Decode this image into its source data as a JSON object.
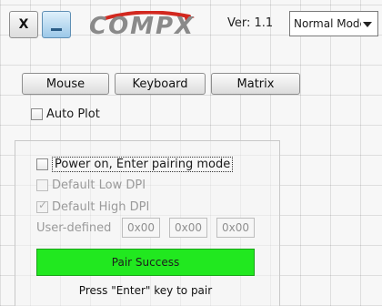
{
  "titlebar": {
    "close_label": "X",
    "logo_text": "COMPX",
    "version_label": "Ver: 1.1",
    "mode_select": {
      "selected": "Normal Mode"
    }
  },
  "tabs": [
    {
      "label": "Mouse"
    },
    {
      "label": "Keyboard"
    },
    {
      "label": "Matrix"
    }
  ],
  "auto_plot": {
    "label": "Auto Plot",
    "checked": false
  },
  "pairing": {
    "power_on": {
      "label": "Power on, Enter pairing mode",
      "checked": false
    },
    "default_low_dpi": {
      "label": "Default Low DPI",
      "checked": false,
      "enabled": false
    },
    "default_high_dpi": {
      "label": "Default High DPI",
      "checked": true,
      "enabled": false
    },
    "user_defined": {
      "label": "User-defined",
      "values": [
        "0x00",
        "0x00",
        "0x00"
      ]
    },
    "status_button": {
      "label": "Pair Success",
      "color": "#21e81f"
    },
    "hint": "Press \"Enter\" key to pair"
  }
}
